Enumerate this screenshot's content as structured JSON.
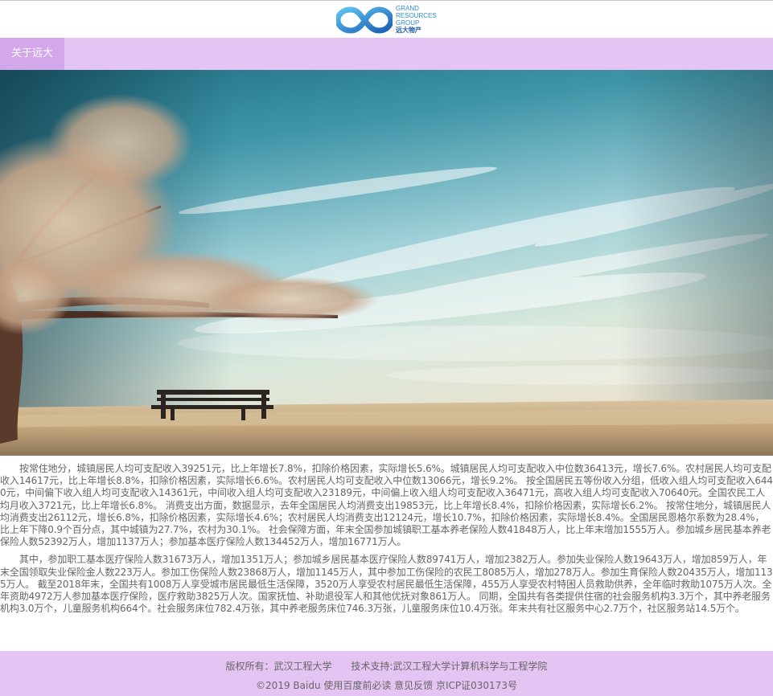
{
  "logo": {
    "line1": "GRAND",
    "line2": "RESOURCES",
    "line3": "GROUP",
    "line4": "远大物产",
    "icon": "infinity-logo"
  },
  "nav": {
    "items": [
      {
        "label": "关于远大"
      }
    ]
  },
  "hero": {
    "image": "tree-and-bench-under-blue-sky"
  },
  "content": {
    "paragraphs": [
      "按常住地分，城镇居民人均可支配收入39251元，比上年增长7.8%，扣除价格因素，实际增长5.6%。城镇居民人均可支配收入中位数36413元，增长7.6%。农村居民人均可支配收入14617元，比上年增长8.8%，扣除价格因素，实际增长6.6%。农村居民人均可支配收入中位数13066元，增长9.2%。 按全国居民五等份收入分组，低收入组人均可支配收入6440元，中间偏下收入组人均可支配收入14361元，中间收入组人均可支配收入23189元，中间偏上收入组人均可支配收入36471元，高收入组人均可支配收入70640元。全国农民工人均月收入3721元，比上年增长6.8%。 消费支出方面，数据显示，去年全国居民人均消费支出19853元，比上年增长8.4%，扣除价格因素，实际增长6.2%。 按常住地分，城镇居民人均消费支出26112元，增长6.8%，扣除价格因素，实际增长4.6%；农村居民人均消费支出12124元，增长10.7%，扣除价格因素，实际增长8.4%。全国居民恩格尔系数为28.4%，比上年下降0.9个百分点，其中城镇为27.7%，农村为30.1%。 社会保障方面，年末全国参加城镇职工基本养老保险人数41848万人，比上年末增加1555万人。参加城乡居民基本养老保险人数52392万人，增加1137万人；参加基本医疗保险人数134452万人，增加16771万人。",
      "其中，参加职工基本医疗保险人数31673万人，增加1351万人；参加城乡居民基本医疗保险人数89741万人，增加2382万人。参加失业保险人数19643万人，增加859万人，年末全国领取失业保险金人数223万人。参加工伤保险人数23868万人，增加1145万人，其中参加工伤保险的农民工8085万人，增加278万人。参加生育保险人数20435万人，增加1135万人。 截至2018年末，全国共有1008万人享受城市居民最低生活保障，3520万人享受农村居民最低生活保障，455万人享受农村特困人员救助供养，全年临时救助1075万人次。全年资助4972万人参加基本医疗保险，医疗救助3825万人次。国家抚恤、补助退役军人和其他优抚对象861万人。 同期，全国共有各类提供住宿的社会服务机构3.3万个，其中养老服务机构3.0万个，儿童服务机构664个。社会服务床位782.4万张，其中养老服务床位746.3万张，儿童服务床位10.4万张。年末共有社区服务中心2.7万个，社区服务站14.5万个。"
    ]
  },
  "footer": {
    "copyright": "版权所有：武汉工程大学",
    "support": "技术支持:武汉工程大学计算机科学与工程学院",
    "baidu": "©2019 Baidu 使用百度前必读 意见反馈 京ICP证030173号"
  },
  "colors": {
    "nav_bg": "#e4c4f2",
    "nav_active": "#d2a8ea",
    "footer_bg": "#e4c4f2",
    "logo_blue": "#2e8fd0"
  }
}
